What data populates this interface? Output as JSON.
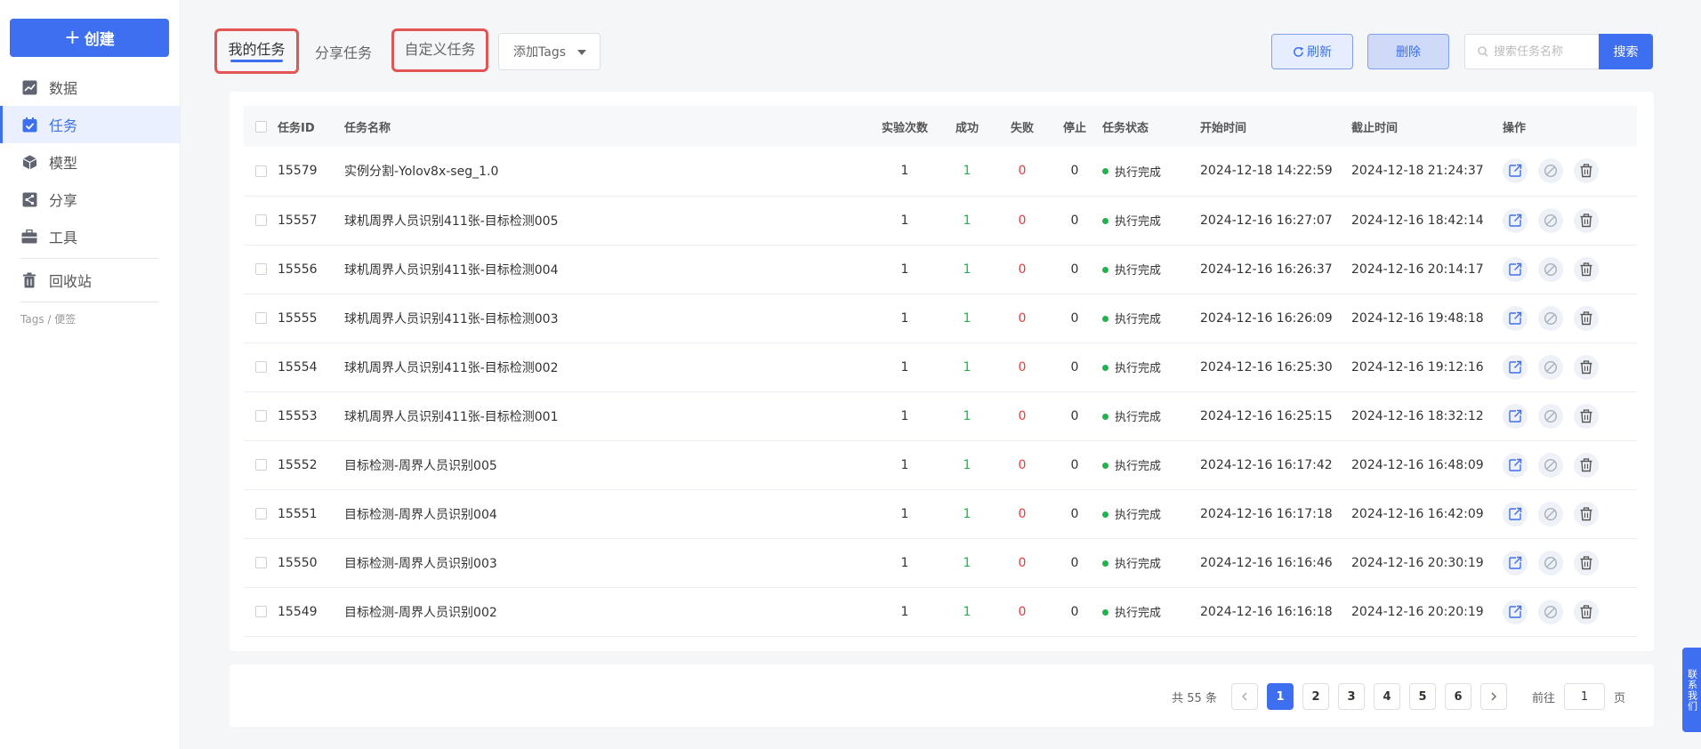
{
  "sidebar": {
    "create_label": "创建",
    "items": [
      {
        "label": "数据",
        "icon": "chart-icon",
        "active": false
      },
      {
        "label": "任务",
        "icon": "task-icon",
        "active": true
      },
      {
        "label": "模型",
        "icon": "cube-icon",
        "active": false
      },
      {
        "label": "分享",
        "icon": "share-icon",
        "active": false
      },
      {
        "label": "工具",
        "icon": "toolbox-icon",
        "active": false
      },
      {
        "label": "回收站",
        "icon": "trash-icon",
        "active": false
      }
    ],
    "tags_label": "Tags / 便签"
  },
  "tabs": {
    "mine": "我的任务",
    "share": "分享任务",
    "custom": "自定义任务"
  },
  "toolbar": {
    "add_tags": "添加Tags",
    "refresh": "刷新",
    "delete": "删除",
    "search_placeholder": "搜索任务名称",
    "search": "搜索"
  },
  "table": {
    "headers": {
      "id": "任务ID",
      "name": "任务名称",
      "runs": "实验次数",
      "success": "成功",
      "fail": "失败",
      "stop": "停止",
      "status": "任务状态",
      "start": "开始时间",
      "end": "截止时间",
      "ops": "操作"
    },
    "rows": [
      {
        "id": "15579",
        "name": "实例分割-Yolov8x-seg_1.0",
        "runs": "1",
        "success": "1",
        "fail": "0",
        "stop": "0",
        "status": "执行完成",
        "start": "2024-12-18 14:22:59",
        "end": "2024-12-18 21:24:37"
      },
      {
        "id": "15557",
        "name": "球机周界人员识别411张-目标检测005",
        "runs": "1",
        "success": "1",
        "fail": "0",
        "stop": "0",
        "status": "执行完成",
        "start": "2024-12-16 16:27:07",
        "end": "2024-12-16 18:42:14"
      },
      {
        "id": "15556",
        "name": "球机周界人员识别411张-目标检测004",
        "runs": "1",
        "success": "1",
        "fail": "0",
        "stop": "0",
        "status": "执行完成",
        "start": "2024-12-16 16:26:37",
        "end": "2024-12-16 20:14:17"
      },
      {
        "id": "15555",
        "name": "球机周界人员识别411张-目标检测003",
        "runs": "1",
        "success": "1",
        "fail": "0",
        "stop": "0",
        "status": "执行完成",
        "start": "2024-12-16 16:26:09",
        "end": "2024-12-16 19:48:18"
      },
      {
        "id": "15554",
        "name": "球机周界人员识别411张-目标检测002",
        "runs": "1",
        "success": "1",
        "fail": "0",
        "stop": "0",
        "status": "执行完成",
        "start": "2024-12-16 16:25:30",
        "end": "2024-12-16 19:12:16"
      },
      {
        "id": "15553",
        "name": "球机周界人员识别411张-目标检测001",
        "runs": "1",
        "success": "1",
        "fail": "0",
        "stop": "0",
        "status": "执行完成",
        "start": "2024-12-16 16:25:15",
        "end": "2024-12-16 18:32:12"
      },
      {
        "id": "15552",
        "name": "目标检测-周界人员识别005",
        "runs": "1",
        "success": "1",
        "fail": "0",
        "stop": "0",
        "status": "执行完成",
        "start": "2024-12-16 16:17:42",
        "end": "2024-12-16 16:48:09"
      },
      {
        "id": "15551",
        "name": "目标检测-周界人员识别004",
        "runs": "1",
        "success": "1",
        "fail": "0",
        "stop": "0",
        "status": "执行完成",
        "start": "2024-12-16 16:17:18",
        "end": "2024-12-16 16:42:09"
      },
      {
        "id": "15550",
        "name": "目标检测-周界人员识别003",
        "runs": "1",
        "success": "1",
        "fail": "0",
        "stop": "0",
        "status": "执行完成",
        "start": "2024-12-16 16:16:46",
        "end": "2024-12-16 20:30:19"
      },
      {
        "id": "15549",
        "name": "目标检测-周界人员识别002",
        "runs": "1",
        "success": "1",
        "fail": "0",
        "stop": "0",
        "status": "执行完成",
        "start": "2024-12-16 16:16:18",
        "end": "2024-12-16 20:20:19"
      }
    ]
  },
  "pagination": {
    "total": "共 55 条",
    "pages": [
      "1",
      "2",
      "3",
      "4",
      "5",
      "6"
    ],
    "current": "1",
    "goto_label": "前往",
    "goto_value": "1",
    "page_suffix": "页"
  },
  "contact": "联系我们",
  "colors": {
    "primary": "#3d6ff0",
    "success": "#22b14c",
    "danger": "#ec3a3a",
    "highlight_border": "#e35454"
  }
}
